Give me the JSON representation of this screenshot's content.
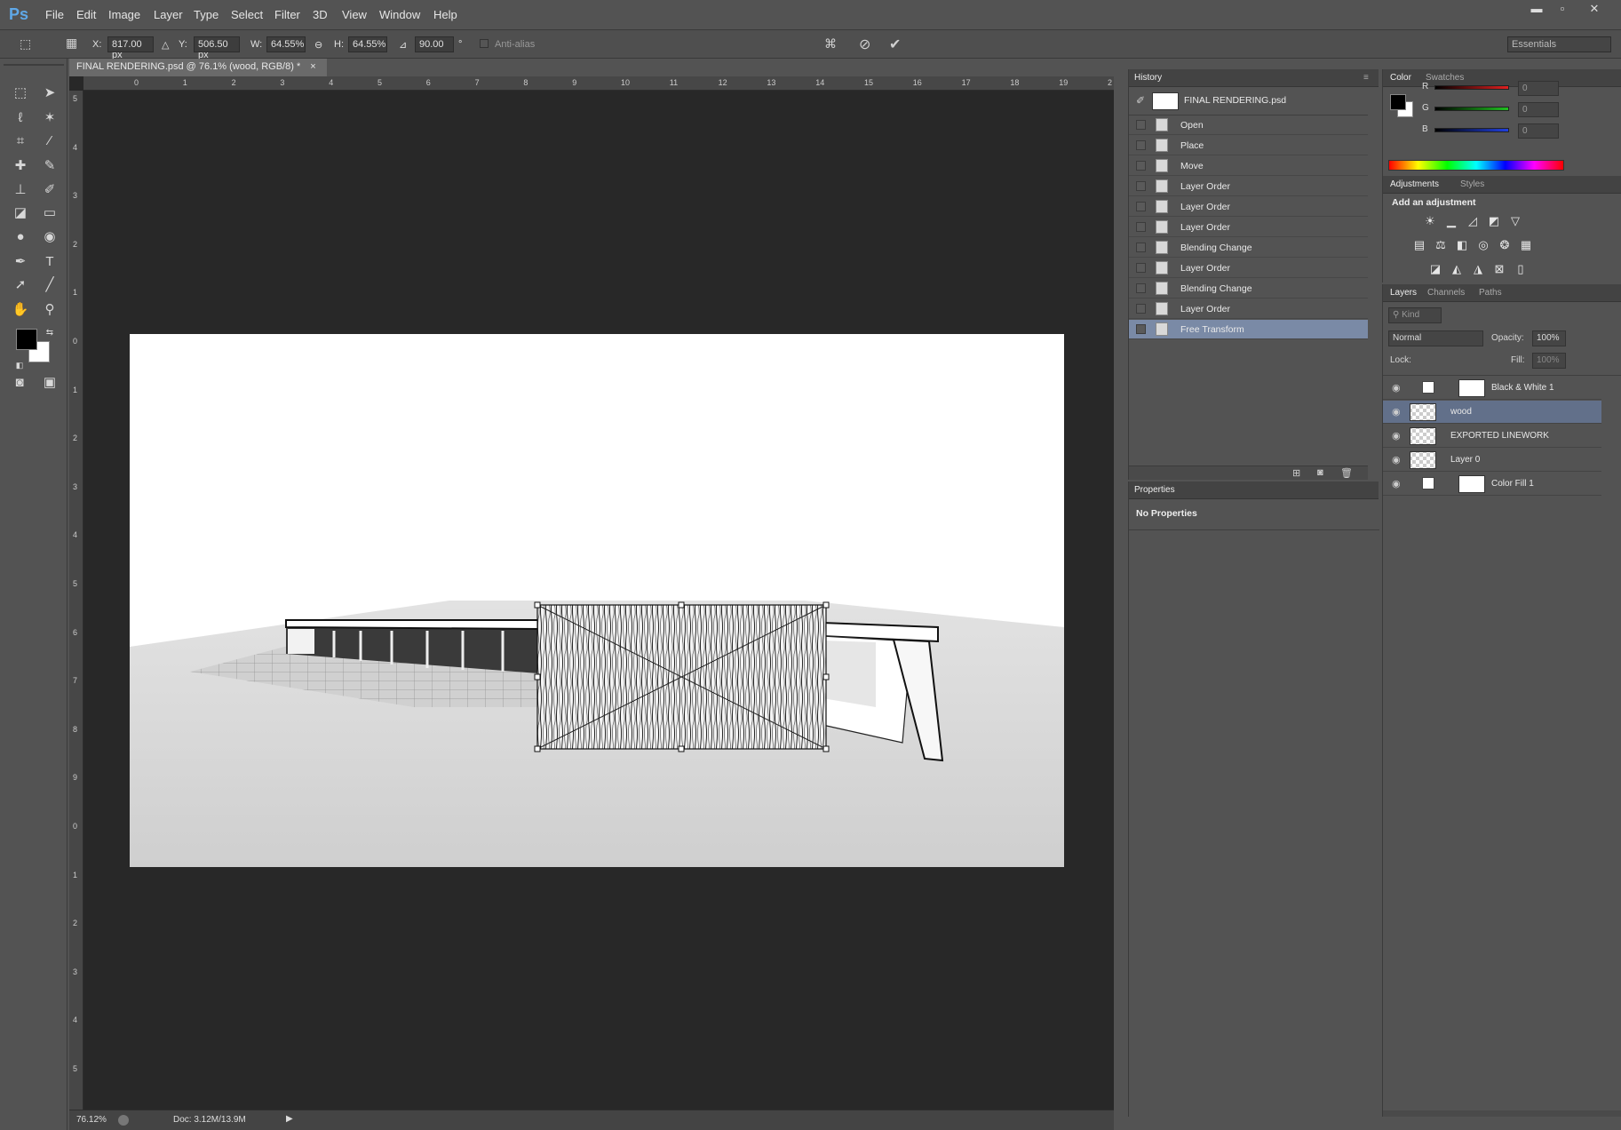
{
  "app": {
    "logo": "Ps"
  },
  "menu": [
    "File",
    "Edit",
    "Image",
    "Layer",
    "Type",
    "Select",
    "Filter",
    "3D",
    "View",
    "Window",
    "Help"
  ],
  "window_controls": {
    "minimize": "▬",
    "maximize": "▫",
    "close": "✕"
  },
  "options": {
    "x_label": "X:",
    "x_value": "817.00 px",
    "y_label": "Y:",
    "y_value": "506.50 px",
    "w_label": "W:",
    "w_value": "64.55%",
    "h_label": "H:",
    "h_value": "64.55%",
    "angle_value": "90.00",
    "angle_unit": "°",
    "antialias_label": "Anti-alias",
    "workspace": "Essentials"
  },
  "document": {
    "tab_title": "FINAL RENDERING.psd @ 76.1% (wood, RGB/8) *",
    "tab_close": "×",
    "zoom": "76.12%",
    "doc_size": "Doc: 3.12M/13.9M",
    "ruler_top": [
      "0",
      "1",
      "2",
      "3",
      "4",
      "5",
      "6",
      "7",
      "8",
      "9",
      "10",
      "11",
      "12",
      "13",
      "14",
      "15",
      "16",
      "17",
      "18",
      "19",
      "2"
    ],
    "ruler_left": [
      "5",
      "4",
      "3",
      "2",
      "1",
      "0",
      "1",
      "2",
      "3",
      "4",
      "5",
      "6",
      "7",
      "8",
      "9",
      "0",
      "1",
      "2",
      "3",
      "4",
      "5"
    ]
  },
  "history": {
    "tabs": [
      "History"
    ],
    "snapshot": "FINAL RENDERING.psd",
    "items": [
      "Open",
      "Place",
      "Move",
      "Layer Order",
      "Layer Order",
      "Layer Order",
      "Blending Change",
      "Layer Order",
      "Blending Change",
      "Layer Order",
      "Free Transform"
    ],
    "selected_index": 10
  },
  "properties": {
    "tab": "Properties",
    "text": "No Properties"
  },
  "color": {
    "tabs": [
      "Color",
      "Swatches"
    ],
    "channels": [
      {
        "label": "R",
        "value": "0",
        "color": "#e02020"
      },
      {
        "label": "G",
        "value": "0",
        "color": "#20c020"
      },
      {
        "label": "B",
        "value": "0",
        "color": "#2040e0"
      }
    ]
  },
  "adjustments": {
    "tabs": [
      "Adjustments",
      "Styles"
    ],
    "heading": "Add an adjustment"
  },
  "layers": {
    "tabs": [
      "Layers",
      "Channels",
      "Paths"
    ],
    "kind_label": "Kind",
    "blend_mode": "Normal",
    "opacity_label": "Opacity:",
    "opacity_value": "100%",
    "lock_label": "Lock:",
    "fill_label": "Fill:",
    "fill_value": "100%",
    "items": [
      {
        "name": "Black & White 1"
      },
      {
        "name": "wood"
      },
      {
        "name": "EXPORTED LINEWORK"
      },
      {
        "name": "Layer 0"
      },
      {
        "name": "Color Fill 1"
      }
    ],
    "selected_index": 1
  },
  "icons": {
    "eye": "eye-icon",
    "move": "move-tool-icon",
    "confirm": "checkmark-icon",
    "cancel": "cancel-icon"
  }
}
